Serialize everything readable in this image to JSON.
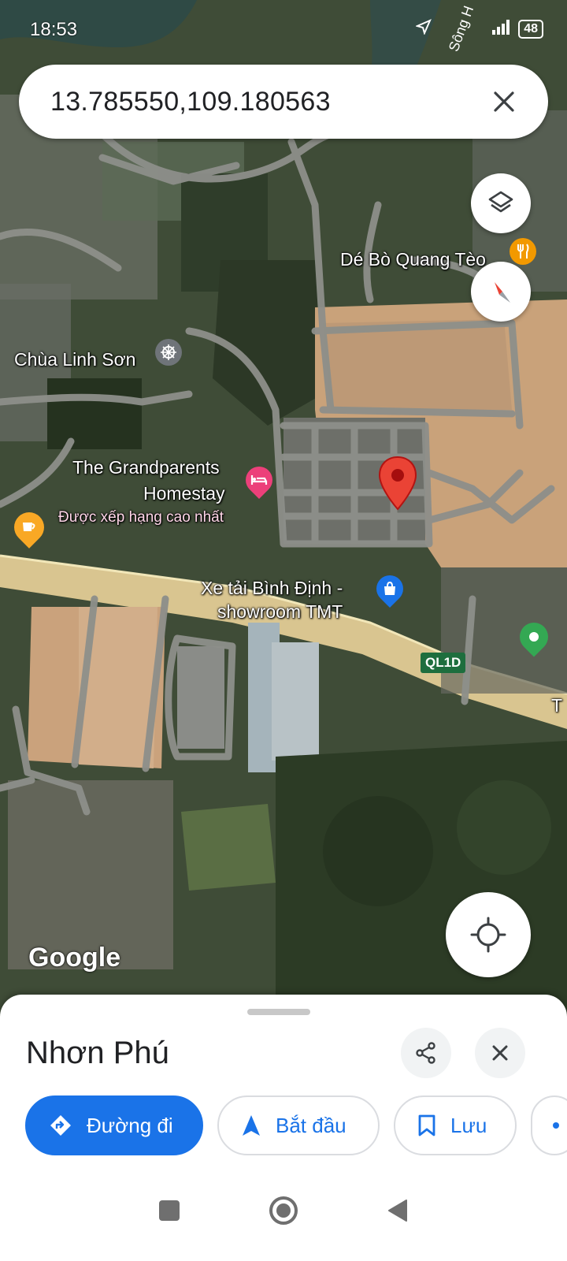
{
  "status_bar": {
    "time": "18:53",
    "battery": "48"
  },
  "search": {
    "query": "13.785550,109.180563"
  },
  "map": {
    "labels": {
      "poi_restaurant": "Dé Bò Quang Tèo",
      "poi_temple": "Chùa Linh Sơn",
      "poi_homestay_line1": "The Grandparents",
      "poi_homestay_line2": "Homestay",
      "poi_homestay_sub": "Được xếp hạng cao nhất",
      "poi_showroom_line1": "Xe tải Bình Định -",
      "poi_showroom_line2": "showroom TMT",
      "road_badge": "QL1D",
      "river": "Sông H",
      "road_edge": "T"
    },
    "attribution": "Google"
  },
  "sheet": {
    "title": "Nhơn Phú",
    "actions": {
      "directions": "Đường đi",
      "start": "Bắt đầu",
      "save": "Lưu"
    }
  },
  "colors": {
    "accent": "#1a73e8",
    "pin": "#ea4335",
    "homestay": "#ec407a",
    "cafe": "#f9a825"
  }
}
